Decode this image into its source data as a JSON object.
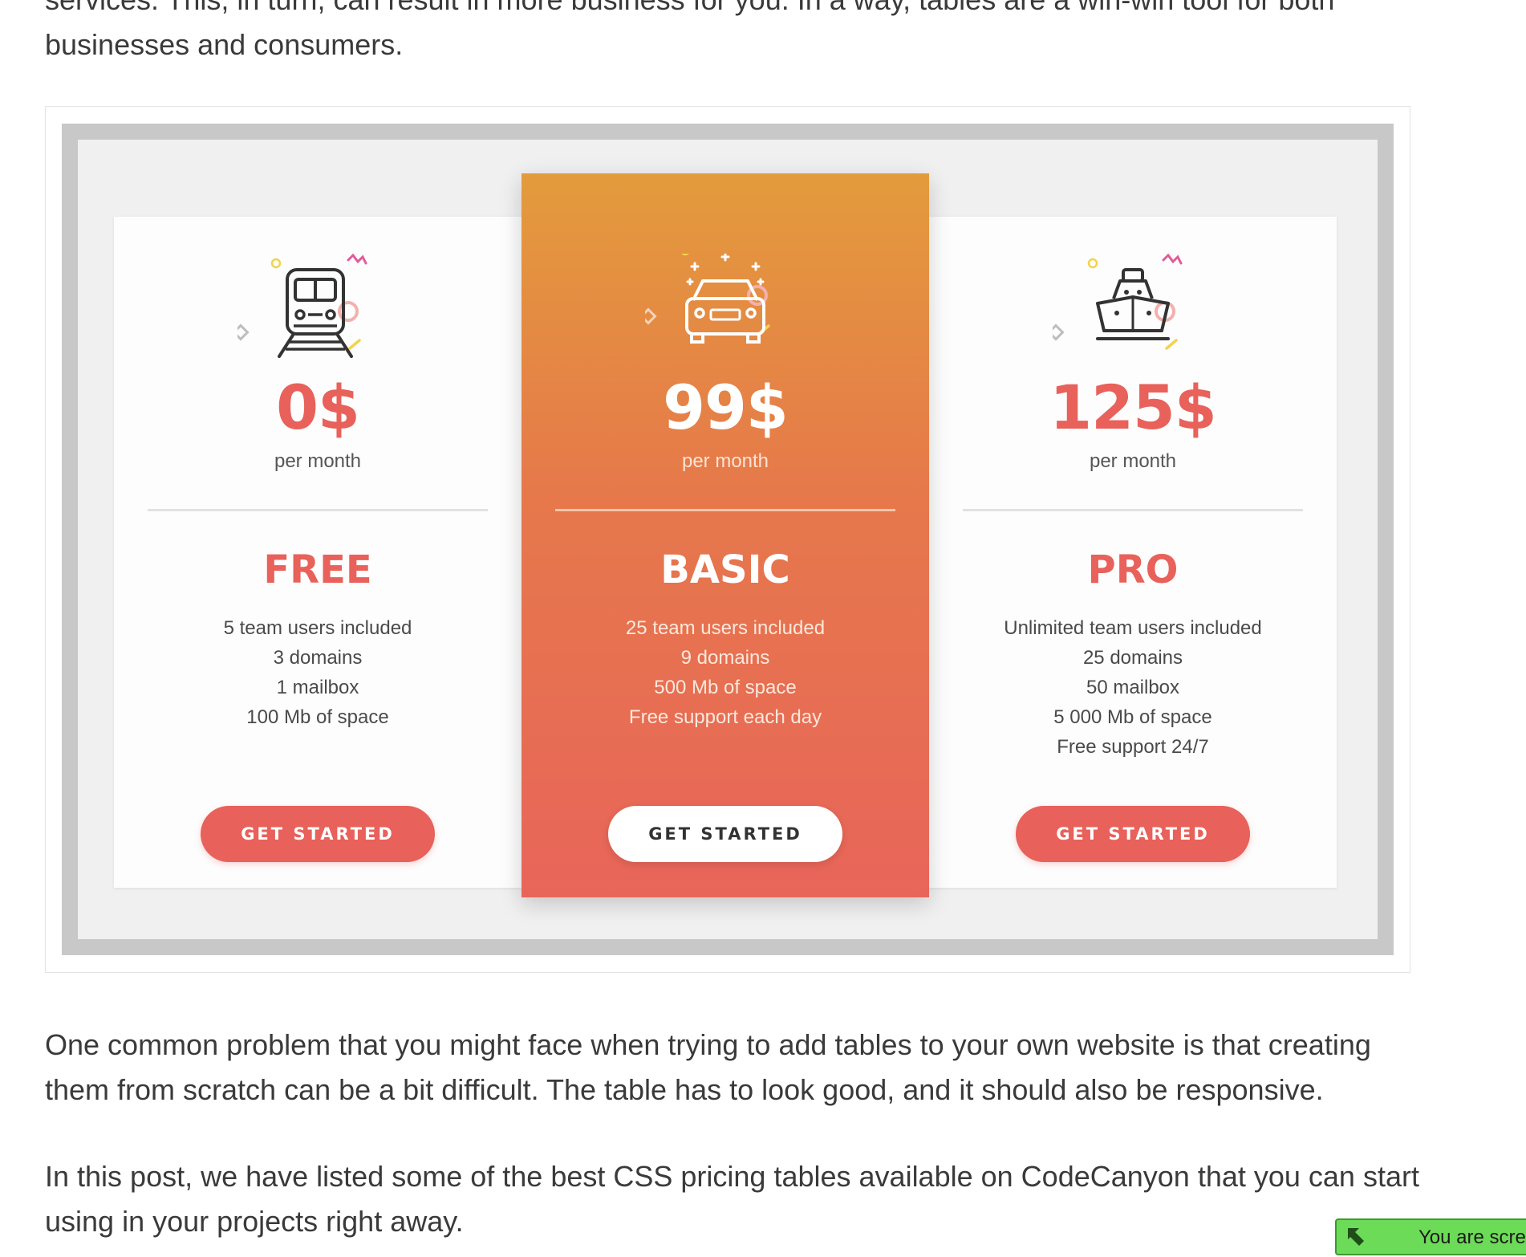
{
  "article": {
    "intro_line_partial": "services. This, in turn, can result in more business for you. In a way, tables are a win-win tool for both",
    "intro_line_2": "businesses and consumers.",
    "paragraph_1": "One common problem that you might face when trying to add tables to your own website is that creating them from scratch can be a bit difficult. The table has to look good, and it should also be responsive.",
    "paragraph_2": "In this post, we have listed some of the best CSS pricing tables available on CodeCanyon that you can start using in your projects right away."
  },
  "pricing": {
    "accent_color": "#e8615a",
    "featured_gradient": [
      "#e39b3c",
      "#e8655a"
    ],
    "plans": [
      {
        "icon": "train-icon",
        "price": "0$",
        "period": "per month",
        "name": "FREE",
        "features": [
          "5 team users included",
          "3 domains",
          "1 mailbox",
          "100 Mb of space"
        ],
        "cta": "GET STARTED"
      },
      {
        "icon": "car-icon",
        "price": "99$",
        "period": "per month",
        "name": "BASIC",
        "features": [
          "25 team users included",
          "9 domains",
          "500 Mb of space",
          "Free support each day"
        ],
        "cta": "GET STARTED",
        "featured": true
      },
      {
        "icon": "ship-icon",
        "price": "125$",
        "period": "per month",
        "name": "PRO",
        "features": [
          "Unlimited team users included",
          "25 domains",
          "50 mailbox",
          "5 000 Mb of space",
          "Free support 24/7"
        ],
        "cta": "GET STARTED"
      }
    ]
  },
  "toast": {
    "icon": "arrow-up-left-icon",
    "text": "You are scre",
    "color": "#6cdb57"
  }
}
